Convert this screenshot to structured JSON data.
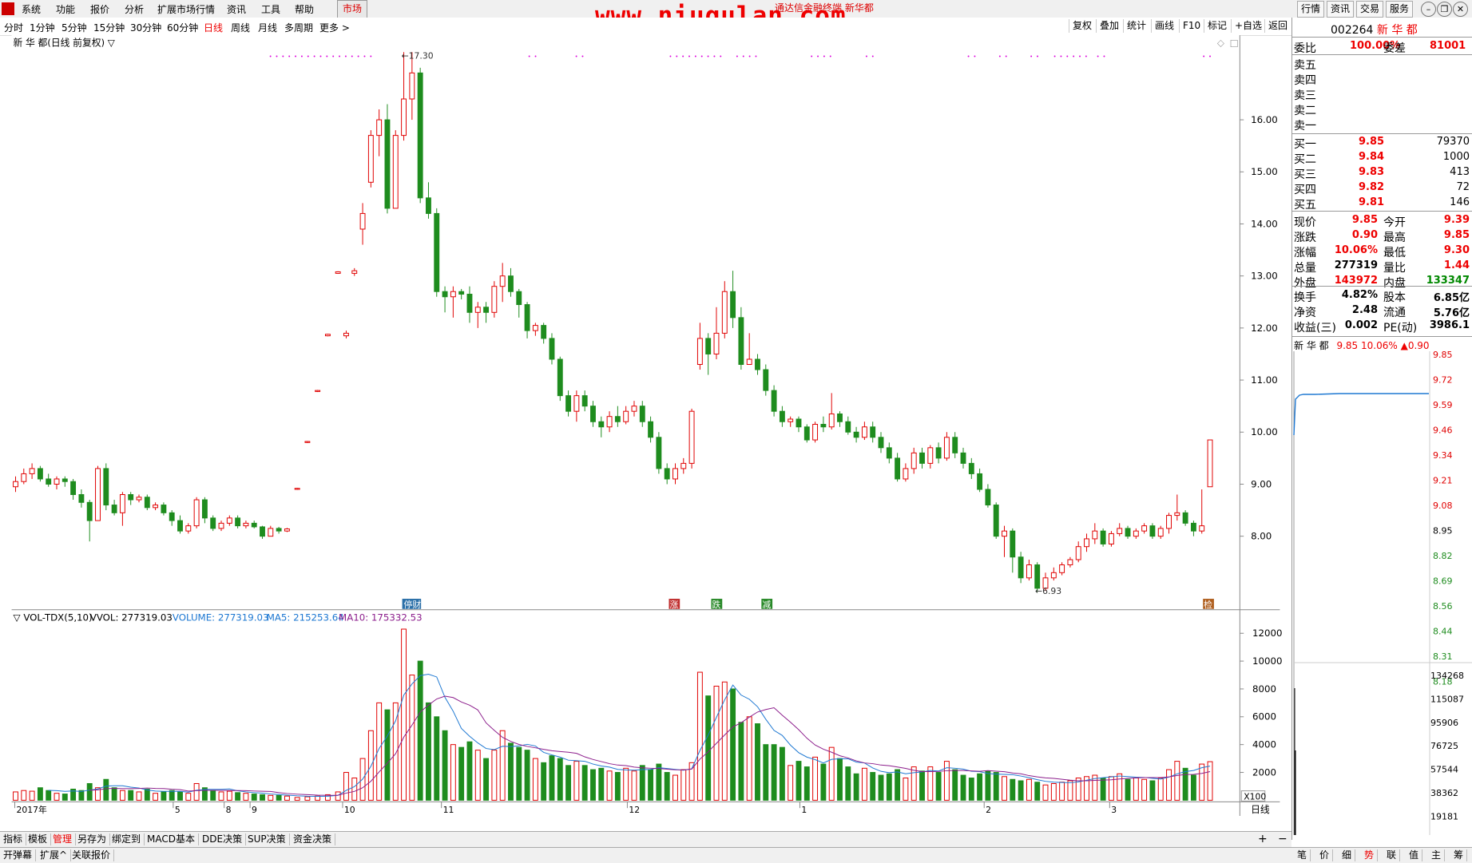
{
  "menu": {
    "items": [
      "系统",
      "功能",
      "报价",
      "分析",
      "扩展市场行情",
      "资讯",
      "工具",
      "帮助"
    ],
    "market": "市场",
    "title": "通达信金融终端 新华都",
    "watermark": "www.niugulan.com",
    "right_buttons": [
      "行情",
      "资讯",
      "交易",
      "服务"
    ]
  },
  "periods": {
    "items": [
      "分时",
      "1分钟",
      "5分钟",
      "15分钟",
      "30分钟",
      "60分钟",
      "日线",
      "周线",
      "月线",
      "多周期",
      "更多 >"
    ],
    "active": "日线"
  },
  "tools": [
    "复权",
    "叠加",
    "统计",
    "画线",
    "F10",
    "标记",
    "+自选",
    "返回"
  ],
  "chart": {
    "title": "新 华 都(日线 前复权) ▽",
    "max_label": "17.30",
    "min_label": "6.93",
    "price_ticks": [
      "16.00",
      "15.00",
      "14.00",
      "13.00",
      "12.00",
      "11.00",
      "10.00",
      "9.00",
      "8.00"
    ],
    "markers": [
      "停财",
      "涨",
      "跌",
      "减",
      "检"
    ],
    "vol_title": "▽ VOL-TDX(5,10)",
    "vvol": "VVOL: 277319.03",
    "volume": "VOLUME: 277319.03",
    "ma5": "MA5: 215253.64",
    "ma10": "MA10: 175332.53",
    "vol_ticks": [
      "12000",
      "10000",
      "8000",
      "6000",
      "4000",
      "2000"
    ],
    "vol_unit": "X100",
    "date_labels": [
      "2017年",
      "5",
      "8",
      "9",
      "10",
      "11",
      "12",
      "1",
      "2",
      "3"
    ],
    "period_label": "日线",
    "colors": {
      "up": "#e00000",
      "down": "#1e8c1e",
      "ma5": "#1e78d2",
      "ma10": "#8c1e8c",
      "purple_dots": "#dd00dd"
    }
  },
  "quote": {
    "code": "002264",
    "name": "新 华 都",
    "weibi_label": "委比",
    "weibi": "100.00%",
    "weicha_label": "委差",
    "weicha": "81001",
    "sells": [
      "卖五",
      "卖四",
      "卖三",
      "卖二",
      "卖一"
    ],
    "buys": [
      {
        "label": "买一",
        "price": "9.85",
        "vol": "79370"
      },
      {
        "label": "买二",
        "price": "9.84",
        "vol": "1000"
      },
      {
        "label": "买三",
        "price": "9.83",
        "vol": "413"
      },
      {
        "label": "买四",
        "price": "9.82",
        "vol": "72"
      },
      {
        "label": "买五",
        "price": "9.81",
        "vol": "146"
      }
    ],
    "stats": [
      {
        "l1": "现价",
        "v1": "9.85",
        "l2": "今开",
        "v2": "9.39"
      },
      {
        "l1": "涨跌",
        "v1": "0.90",
        "l2": "最高",
        "v2": "9.85"
      },
      {
        "l1": "涨幅",
        "v1": "10.06%",
        "l2": "最低",
        "v2": "9.30"
      },
      {
        "l1": "总量",
        "v1": "277319",
        "l2": "量比",
        "v2": "1.44"
      },
      {
        "l1": "外盘",
        "v1": "143972",
        "l2": "内盘",
        "v2": "133347"
      }
    ],
    "stats2": [
      {
        "l1": "换手",
        "v1": "4.82%",
        "l2": "股本",
        "v2": "6.85亿"
      },
      {
        "l1": "净资",
        "v1": "2.48",
        "l2": "流通",
        "v2": "5.76亿"
      },
      {
        "l1": "收益(三)",
        "v1": "0.002",
        "l2": "PE(动)",
        "v2": "3986.1"
      }
    ],
    "mini_header": "新 华 都",
    "mini_price": "9.85",
    "mini_pct": "10.06%",
    "mini_chg": "▲0.90",
    "mini_price_ticks": [
      "9.85",
      "9.72",
      "9.59",
      "9.46",
      "9.34",
      "9.21",
      "9.08",
      "8.95",
      "8.82",
      "8.69",
      "8.56",
      "8.44",
      "8.31",
      "8.18"
    ],
    "mini_vol_ticks": [
      "134268",
      "115087",
      "95906",
      "76725",
      "57544",
      "38362",
      "19181"
    ]
  },
  "bottom_tabs": [
    "指标",
    "模板",
    "管理",
    "另存为",
    "绑定到",
    "MACD基本",
    "DDE决策",
    "SUP决策",
    "资金决策"
  ],
  "bottom_tabs_active": "管理",
  "bottom_row2": [
    "开弹幕",
    "扩展^",
    "关联报价"
  ],
  "bottom_right": [
    "笔",
    "价",
    "细",
    "势",
    "联",
    "值",
    "主",
    "筹"
  ],
  "bottom_right_active": "势"
}
